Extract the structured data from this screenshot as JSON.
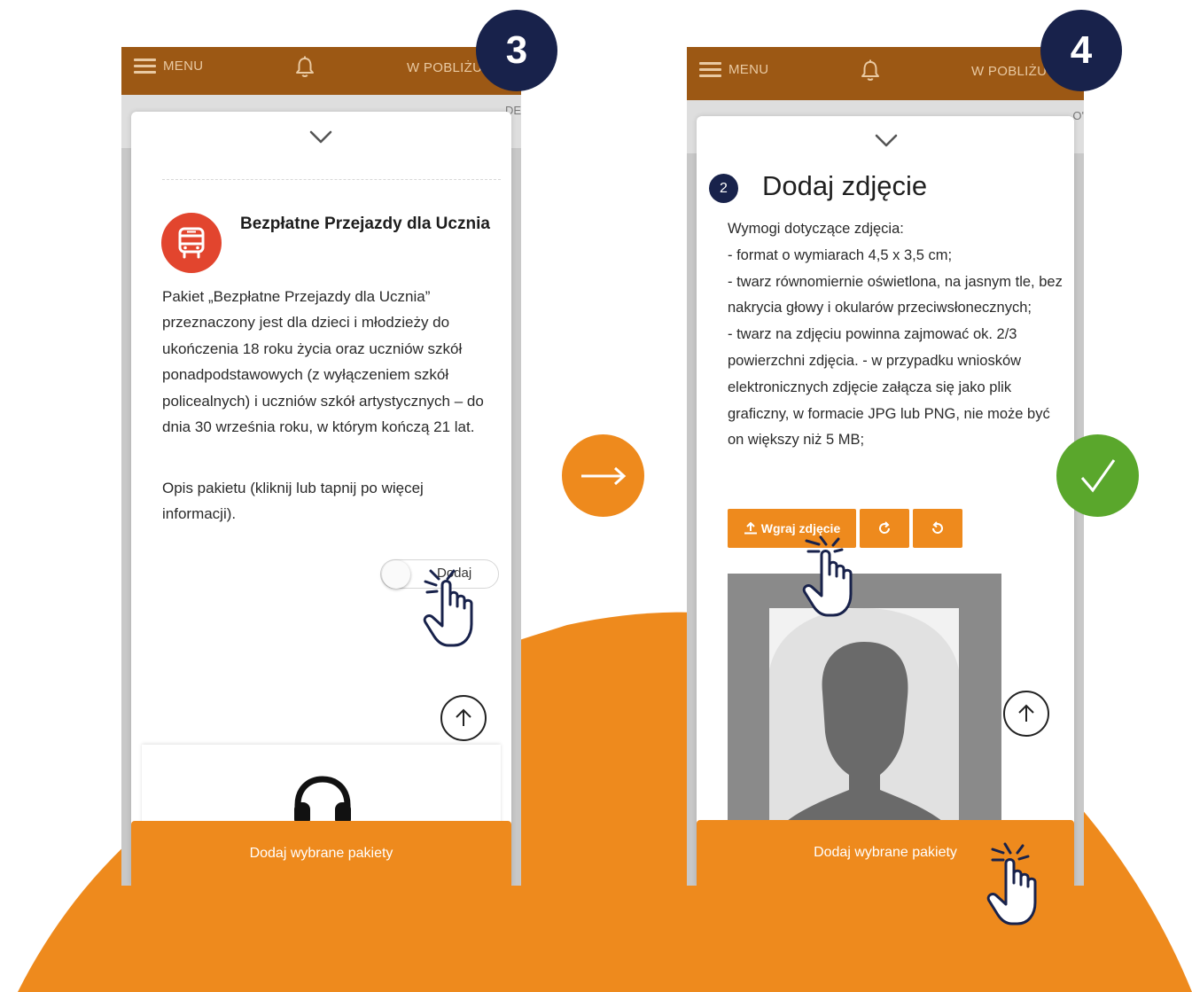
{
  "steps": [
    {
      "number": "3",
      "appbar": {
        "menu_label": "MENU",
        "nearby_label": "W POBLIŻU"
      },
      "subbar_edge_text": "DE",
      "package": {
        "title": "Bezpłatne Przejazdy dla Ucznia",
        "description": "Pakiet „Bezpłatne Przejazdy dla Ucznia” przeznaczony jest dla dzieci i młodzieży do ukończenia 18 roku życia oraz uczniów szkół ponadpodstawowych (z wyłączeniem szkół policealnych) i uczniów szkół artystycznych – do dnia 30 września roku, w którym kończą 21 lat.",
        "more_info": "Opis pakietu (kliknij lub tapnij po więcej informacji).",
        "toggle_label": "Dodaj",
        "toggle_on": false
      },
      "bottom_button": "Dodaj wybrane pakiety"
    },
    {
      "number": "4",
      "appbar": {
        "menu_label": "MENU",
        "nearby_label": "W POBLIŻU"
      },
      "subbar_edge_text": "O'",
      "section": {
        "step_index": "2",
        "title": "Dodaj zdjęcie",
        "requirements": [
          "Wymogi dotyczące zdjęcia:",
          "- format o wymiarach 4,5 x 3,5 cm;",
          "- twarz równomiernie oświetlona, na jasnym tle, bez nakrycia głowy i okularów przeciwsłonecznych;",
          "- twarz na zdjęciu powinna zajmować ok. 2/3 powierzchni zdjęcia. - w przypadku wniosków elektronicznych zdjęcie załącza się jako plik graficzny, w formacie JPG lub PNG, nie może być on większy niż 5 MB;"
        ],
        "upload_button": "Wgraj zdjęcie",
        "rotate_right_icon": "rotate-right-icon",
        "rotate_left_icon": "rotate-left-icon"
      },
      "bottom_button": "Dodaj wybrane pakiety"
    }
  ],
  "colors": {
    "orange": "#ee8a1d",
    "appbar_brown": "#9c5814",
    "navy": "#18224b",
    "green": "#5aa72c",
    "bus_red": "#e2452e"
  }
}
